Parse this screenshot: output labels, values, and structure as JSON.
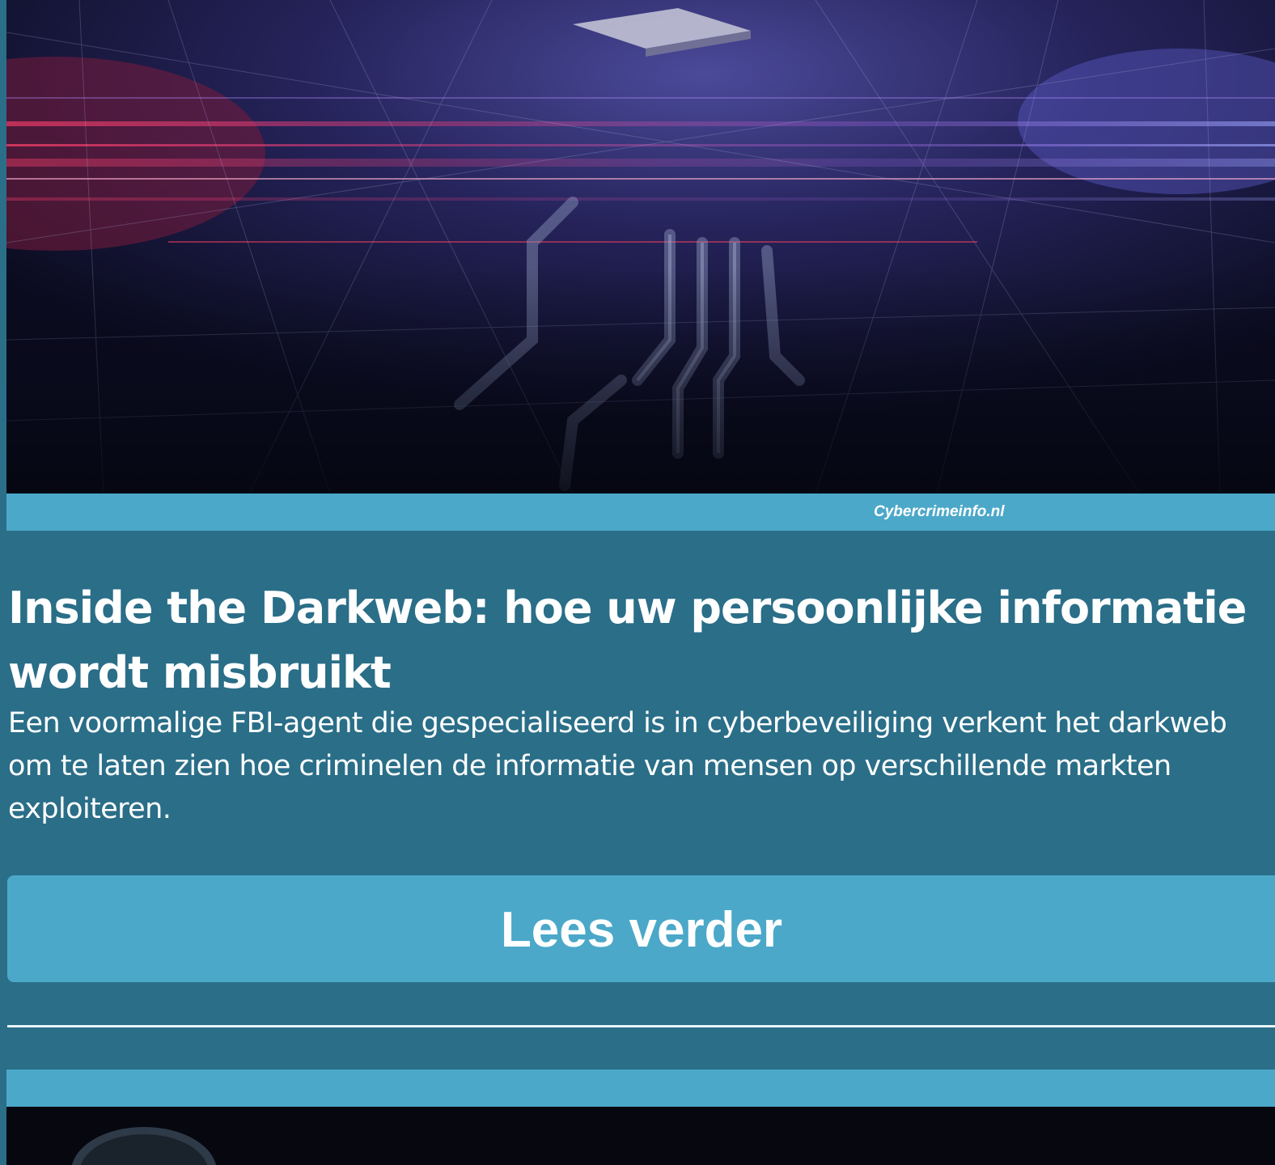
{
  "article": {
    "image_caption": "Cybercrimeinfo.nl",
    "title": "Inside the Darkweb: hoe uw persoonlijke informatie wordt misbruikt",
    "summary": "Een voormalige FBI-agent die gespecialiseerd is in cyberbeveiliging verkent het darkweb om te laten zien hoe criminelen de informatie van mensen op verschillende markten exploiteren.",
    "read_more_label": "Lees verder"
  },
  "colors": {
    "background": "#2a6e88",
    "accent": "#4ba8c9",
    "text": "#ffffff"
  }
}
